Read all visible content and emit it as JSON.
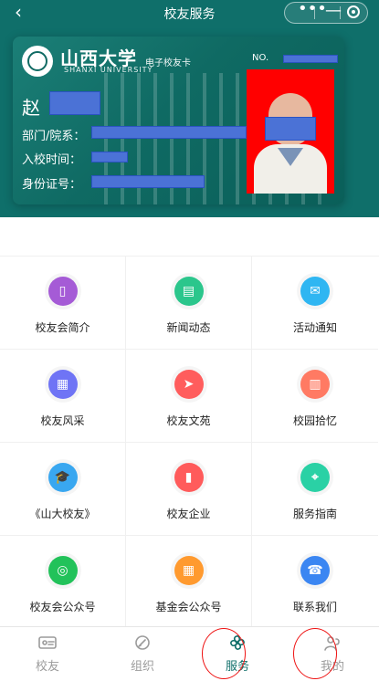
{
  "topbar": {
    "title": "校友服务",
    "back_icon": "chevron-left-icon",
    "menu_icon": "more-dots-icon",
    "minimize_icon": "minus-icon",
    "close_icon": "target-icon"
  },
  "card": {
    "university_cn": "山西大学",
    "university_en": "SHANXI UNIVERSITY",
    "card_name": "电子校友卡",
    "no_label": "NO.",
    "surname": "赵",
    "fields": [
      {
        "label": "部门/院系："
      },
      {
        "label": "入校时间："
      },
      {
        "label": "身份证号："
      }
    ]
  },
  "services": [
    {
      "label": "校友会简介",
      "color": "#a55bd6",
      "icon": "book-icon",
      "glyph": "▯"
    },
    {
      "label": "新闻动态",
      "color": "#2bc68c",
      "icon": "newspaper-icon",
      "glyph": "▤"
    },
    {
      "label": "活动通知",
      "color": "#2fb6f2",
      "icon": "megaphone-icon",
      "glyph": "✉"
    },
    {
      "label": "校友风采",
      "color": "#6f74f5",
      "icon": "clapperboard-icon",
      "glyph": "▦"
    },
    {
      "label": "校友文苑",
      "color": "#ff5d5d",
      "icon": "paper-plane-icon",
      "glyph": "➤"
    },
    {
      "label": "校园拾忆",
      "color": "#ff7a63",
      "icon": "campus-gate-icon",
      "glyph": "▥"
    },
    {
      "label": "《山大校友》",
      "color": "#39a7f0",
      "icon": "graduation-cap-icon",
      "glyph": "🎓"
    },
    {
      "label": "校友企业",
      "color": "#ff5b5b",
      "icon": "building-icon",
      "glyph": "▮"
    },
    {
      "label": "服务指南",
      "color": "#2ad1a5",
      "icon": "compass-icon",
      "glyph": "⌖"
    },
    {
      "label": "校友会公众号",
      "color": "#22c25a",
      "icon": "wechat-icon",
      "glyph": "◎"
    },
    {
      "label": "基金会公众号",
      "color": "#ff9a2f",
      "icon": "calendar-icon",
      "glyph": "▦"
    },
    {
      "label": "联系我们",
      "color": "#3b86f2",
      "icon": "phone-icon",
      "glyph": "☎"
    }
  ],
  "tabbar": {
    "tabs": [
      {
        "label": "校友",
        "icon": "id-card-icon"
      },
      {
        "label": "组织",
        "icon": "pen-icon"
      },
      {
        "label": "服务",
        "icon": "cloverleaf-icon"
      },
      {
        "label": "我的",
        "icon": "users-icon"
      }
    ],
    "active_index": 2
  },
  "colors": {
    "brand_green": "#0f6f6a",
    "redaction_blue": "#4b72d6",
    "annotation_red": "#e11111"
  }
}
